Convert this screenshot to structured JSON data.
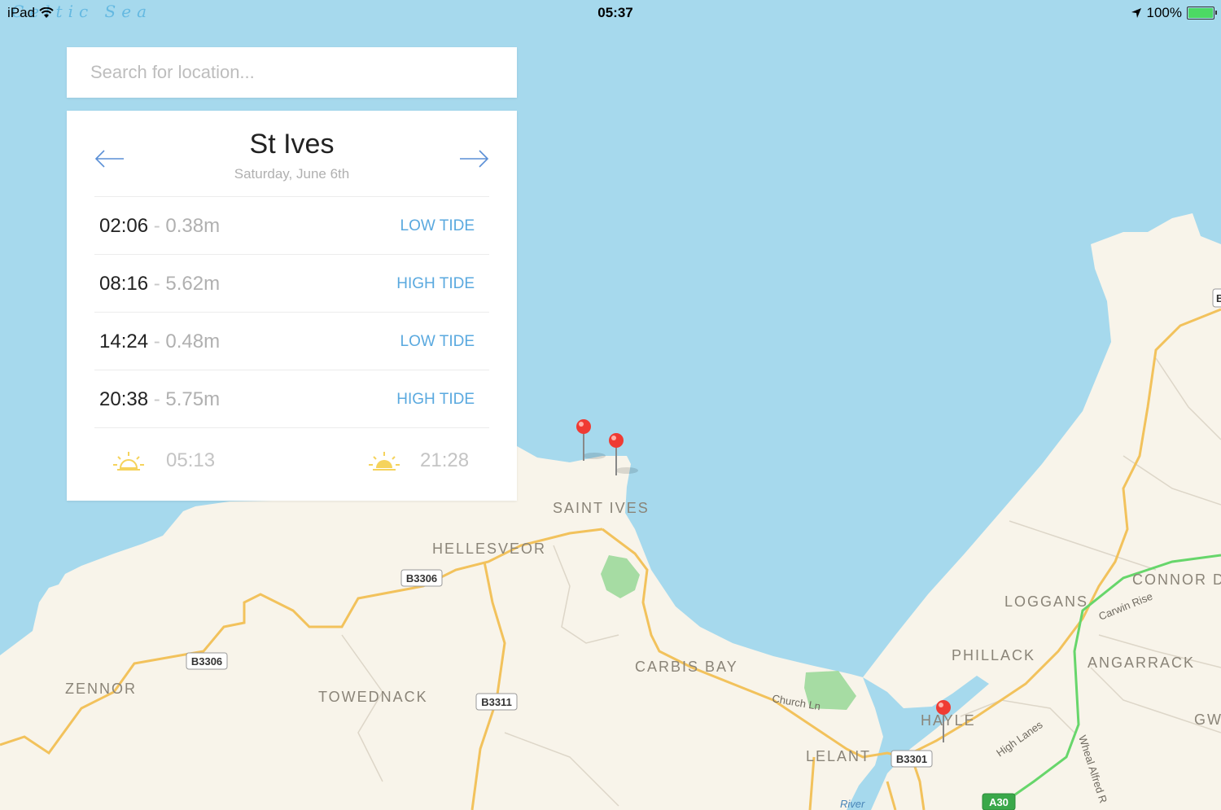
{
  "status_bar": {
    "device": "iPad",
    "app_name": "Celtic Sea",
    "time": "05:37",
    "battery": "100%"
  },
  "search": {
    "placeholder": "Search for location..."
  },
  "tide_card": {
    "location": "St Ives",
    "date": "Saturday, June 6th",
    "tides": [
      {
        "time": "02:06",
        "separator": "-",
        "height": "0.38m",
        "type": "LOW TIDE"
      },
      {
        "time": "08:16",
        "separator": "-",
        "height": "5.62m",
        "type": "HIGH TIDE"
      },
      {
        "time": "14:24",
        "separator": "-",
        "height": "0.48m",
        "type": "LOW TIDE"
      },
      {
        "time": "20:38",
        "separator": "-",
        "height": "5.75m",
        "type": "HIGH TIDE"
      }
    ],
    "sunrise": "05:13",
    "sunset": "21:28"
  },
  "map": {
    "place_labels": [
      "Saint Ives",
      "Hellesveor",
      "Zennor",
      "Towednack",
      "Carbis Bay",
      "Lelant",
      "Hayle",
      "Phillack",
      "Loggans",
      "Connor D",
      "Angarrack",
      "Gw"
    ],
    "street_labels": [
      "Church Ln",
      "Carwin Rise",
      "High Lanes",
      "Wheal Alfred R",
      "River"
    ],
    "road_shields": [
      "B3306",
      "B3306",
      "B3311",
      "B3301",
      "A30"
    ],
    "edge_shield": "B",
    "colors": {
      "sea": "#a6d9ed",
      "land": "#f8f4ea",
      "road": "#f2c25c",
      "park": "#a6dca3",
      "highway": "#67d66b",
      "pin": "#ef3b33"
    }
  }
}
